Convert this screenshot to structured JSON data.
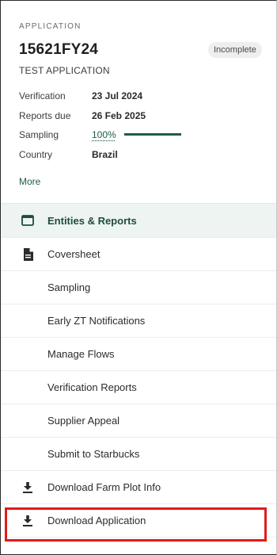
{
  "application": {
    "section_label": "APPLICATION",
    "id": "15621FY24",
    "status": "Incomplete",
    "name": "TEST APPLICATION"
  },
  "details": {
    "verification": {
      "label": "Verification",
      "value": "23 Jul 2024"
    },
    "reports_due": {
      "label": "Reports due",
      "value": "26 Feb 2025"
    },
    "sampling": {
      "label": "Sampling",
      "value": "100%",
      "progress": 1.0
    },
    "country": {
      "label": "Country",
      "value": "Brazil"
    },
    "more_label": "More"
  },
  "nav": {
    "items": [
      {
        "label": "Entities & Reports",
        "icon": "window-icon",
        "active": true
      },
      {
        "label": "Coversheet",
        "icon": "document-icon"
      },
      {
        "label": "Sampling",
        "icon": ""
      },
      {
        "label": "Early ZT Notifications",
        "icon": ""
      },
      {
        "label": "Manage Flows",
        "icon": ""
      },
      {
        "label": "Verification Reports",
        "icon": ""
      },
      {
        "label": "Supplier Appeal",
        "icon": ""
      },
      {
        "label": "Submit to Starbucks",
        "icon": ""
      },
      {
        "label": "Download Farm Plot Info",
        "icon": "download-icon"
      },
      {
        "label": "Download Application",
        "icon": "download-icon"
      }
    ]
  },
  "colors": {
    "accent": "#1e5d46",
    "active_bg": "#eef4f1",
    "highlight": "#e01b1b"
  }
}
